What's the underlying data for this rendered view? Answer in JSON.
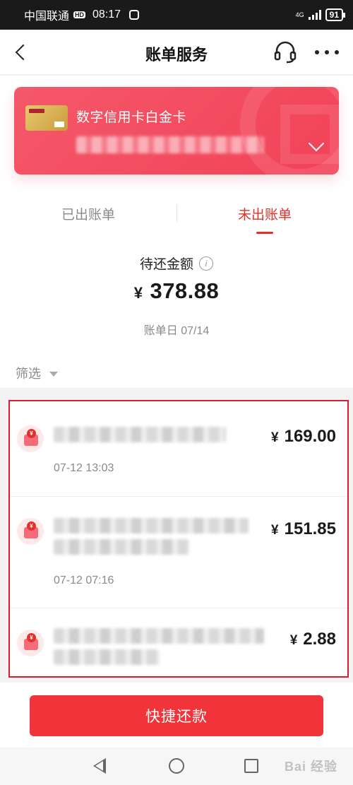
{
  "status_bar": {
    "carrier": "中国联通",
    "hd_badge": "HD",
    "time": "08:17",
    "network": "4G",
    "battery": "91"
  },
  "header": {
    "title": "账单服务",
    "back_icon": "chevron-left-icon",
    "service_icon": "headset-icon",
    "more_icon": "more-dots-icon"
  },
  "card": {
    "name": "数字信用卡白金卡",
    "expand_icon": "chevron-down-icon"
  },
  "tabs": [
    {
      "label": "已出账单",
      "active": false
    },
    {
      "label": "未出账单",
      "active": true
    }
  ],
  "summary": {
    "pending_label": "待还金额",
    "currency": "¥",
    "amount": "378.88",
    "bill_date_label": "账单日 07/14"
  },
  "filter": {
    "label": "筛选"
  },
  "transactions": [
    {
      "amount": "169.00",
      "time": "07-12 13:03"
    },
    {
      "amount": "151.85",
      "time": "07-12 07:16"
    },
    {
      "amount": "2.88",
      "time": ""
    }
  ],
  "actions": {
    "quick_repay_label": "快捷还款"
  },
  "watermark": "Bai 经验",
  "colors": {
    "accent": "#e0322a",
    "card": "#f24257",
    "button": "#f0343a"
  }
}
